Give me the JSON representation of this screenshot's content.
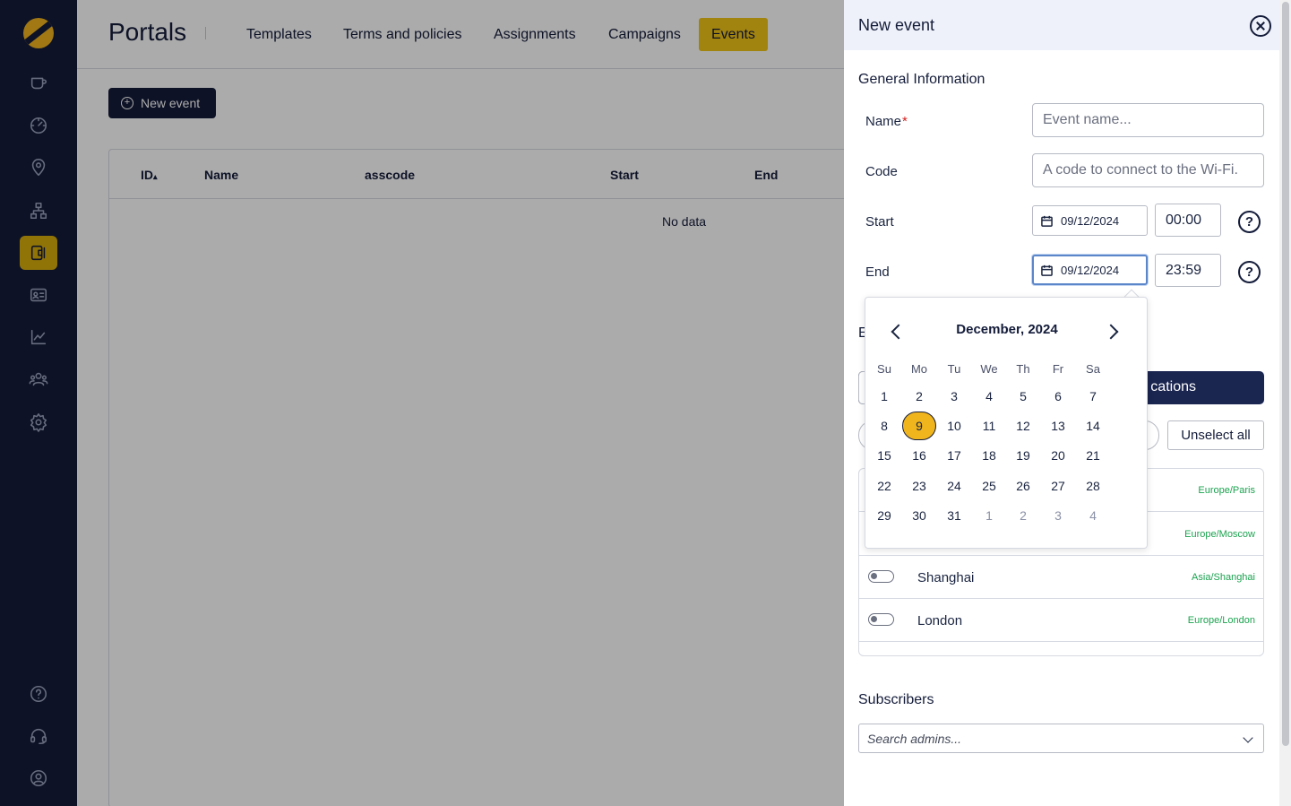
{
  "app": {
    "title": "Portals"
  },
  "nav": {
    "tabs": [
      {
        "label": "Templates"
      },
      {
        "label": "Terms and policies"
      },
      {
        "label": "Assignments"
      },
      {
        "label": "Campaigns"
      },
      {
        "label": "Events",
        "active": true
      }
    ]
  },
  "sidebar": {
    "icons": [
      "cup-icon",
      "gauge-icon",
      "location-pin-icon",
      "network-icon",
      "portal-icon",
      "id-card-icon",
      "chart-icon",
      "users-icon",
      "gear-icon",
      "help-icon",
      "headset-icon",
      "user-circle-icon"
    ],
    "active": "portal-icon",
    "accent": "#d9ae0c"
  },
  "main": {
    "new_event_label": "New event",
    "table": {
      "headers": [
        "ID",
        "Name",
        "asscode",
        "Start",
        "End"
      ],
      "sort_indicator": "▴",
      "empty_text": "No data"
    }
  },
  "drawer": {
    "title": "New event",
    "general_title": "General Information",
    "name": {
      "label": "Name",
      "required_mark": "*",
      "placeholder": "Event name..."
    },
    "code": {
      "label": "Code",
      "placeholder": "A code to connect to the Wi-Fi."
    },
    "start": {
      "label": "Start",
      "date": "09/12/2024",
      "time": "00:00"
    },
    "end": {
      "label": "End",
      "date": "09/12/2024",
      "time": "23:59"
    },
    "help_glyph": "?",
    "hidden_section_initial": "E",
    "select_locations_partial": "cations",
    "unselect_all_label": "Unselect all",
    "locations": [
      {
        "name": "",
        "tz": "Europe/Paris"
      },
      {
        "name": "",
        "tz": "Europe/Moscow"
      },
      {
        "name": "Shanghai",
        "tz": "Asia/Shanghai"
      },
      {
        "name": "London",
        "tz": "Europe/London"
      }
    ],
    "subscribers_title": "Subscribers",
    "subscribers_placeholder": "Search admins..."
  },
  "calendar": {
    "month_label": "December, 2024",
    "weekdays": [
      "Su",
      "Mo",
      "Tu",
      "We",
      "Th",
      "Fr",
      "Sa"
    ],
    "selected_day": 9,
    "weeks": [
      [
        "1",
        "2",
        "3",
        "4",
        "5",
        "6",
        "7"
      ],
      [
        "8",
        "9",
        "10",
        "11",
        "12",
        "13",
        "14"
      ],
      [
        "15",
        "16",
        "17",
        "18",
        "19",
        "20",
        "21"
      ],
      [
        "22",
        "23",
        "24",
        "25",
        "26",
        "27",
        "28"
      ],
      [
        "29",
        "30",
        "31",
        "1",
        "2",
        "3",
        "4"
      ]
    ],
    "other_month_from_week5_index": 3
  }
}
